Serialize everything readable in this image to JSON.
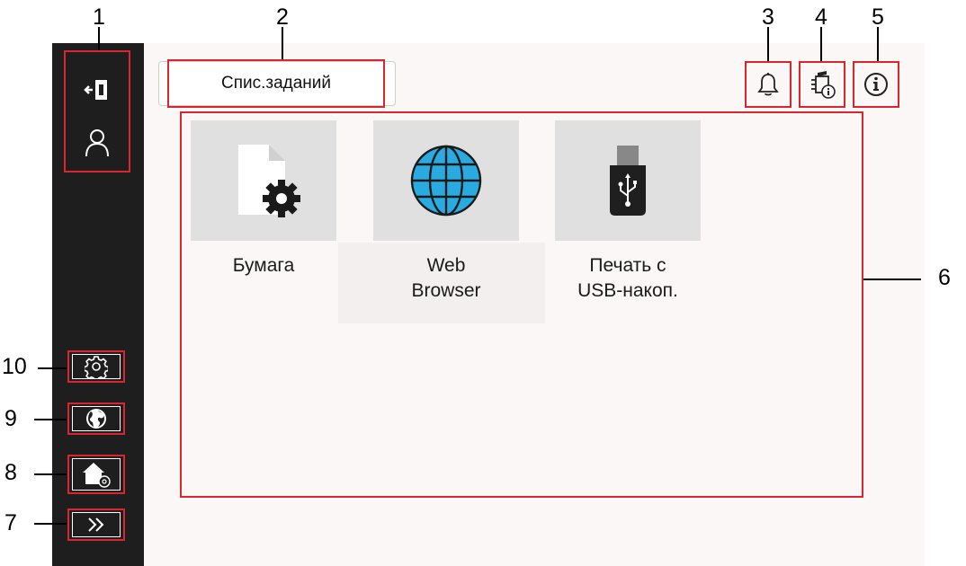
{
  "callouts": {
    "c1": "1",
    "c2": "2",
    "c3": "3",
    "c4": "4",
    "c5": "5",
    "c6": "6",
    "c7": "7",
    "c8": "8",
    "c9": "9",
    "c10": "10"
  },
  "header": {
    "job_list_tab": "Спис.заданий"
  },
  "sidebar": {
    "icons": [
      "logout-icon",
      "user-icon",
      "settings-gear-icon",
      "globe-icon",
      "home-settings-icon",
      "double-chevron-icon"
    ]
  },
  "topbar": {
    "icons": [
      "bell-icon",
      "device-info-icon",
      "info-icon"
    ]
  },
  "apps": [
    {
      "line1": "Бумага",
      "line2": "",
      "icon": "paper-gear-icon"
    },
    {
      "line1": "Web",
      "line2": "Browser",
      "icon": "globe-web-icon"
    },
    {
      "line1": "Печать с",
      "line2": "USB-накоп.",
      "icon": "usb-drive-icon"
    }
  ],
  "colors": {
    "sidebar": "#1e1e1e",
    "main_bg": "#fbf7f7",
    "callout_red": "#d9262c",
    "globe_blue": "#29abe2",
    "tile_gray": "#e0e0e0"
  }
}
